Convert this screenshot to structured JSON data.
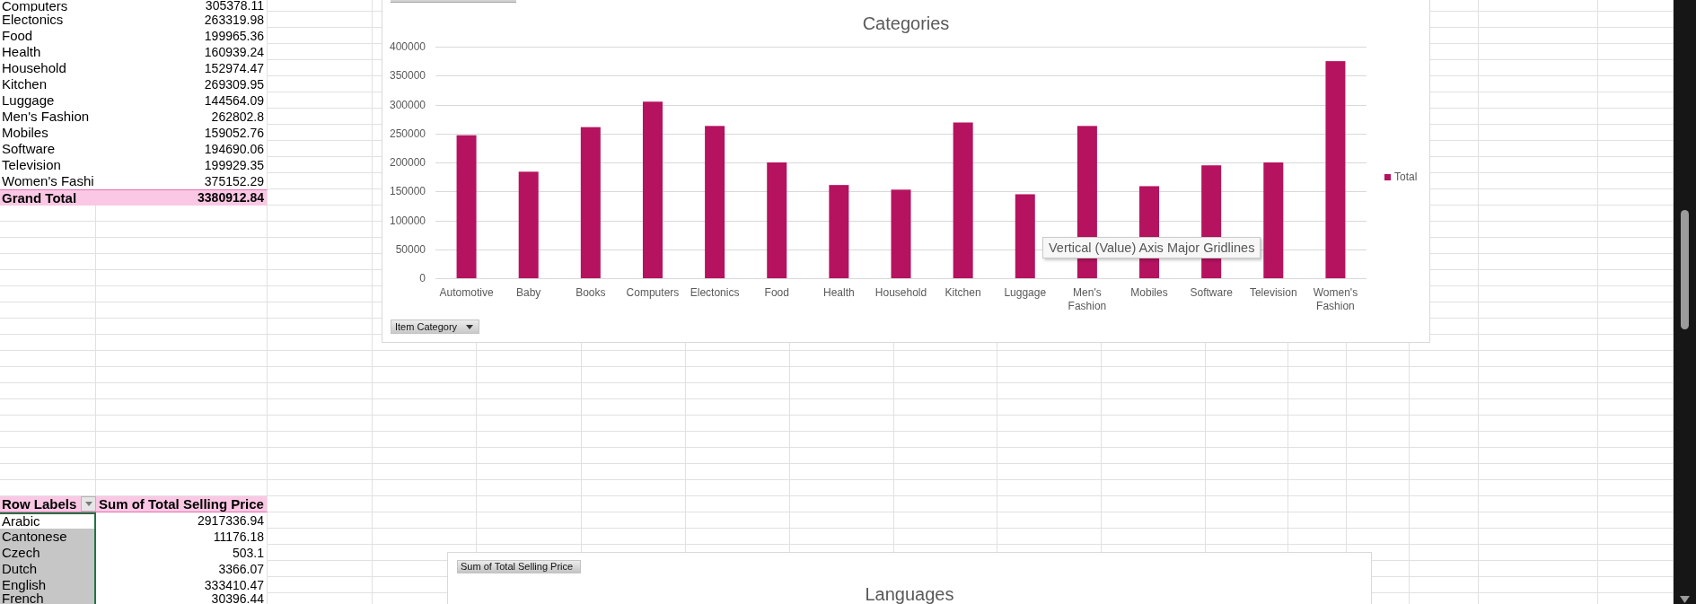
{
  "pivot_categories": {
    "rows": [
      {
        "label": "Computers",
        "value": "305378.11"
      },
      {
        "label": "Electonics",
        "value": "263319.98"
      },
      {
        "label": "Food",
        "value": "199965.36"
      },
      {
        "label": "Health",
        "value": "160939.24"
      },
      {
        "label": "Household",
        "value": "152974.47"
      },
      {
        "label": "Kitchen",
        "value": "269309.95"
      },
      {
        "label": "Luggage",
        "value": "144564.09"
      },
      {
        "label": "Men's Fashion",
        "value": "262802.8"
      },
      {
        "label": "Mobiles",
        "value": "159052.76"
      },
      {
        "label": "Software",
        "value": "194690.06"
      },
      {
        "label": "Television",
        "value": "199929.35"
      },
      {
        "label": "Women's Fashi",
        "value": "375152.29"
      }
    ],
    "grand_total": {
      "label": "Grand Total",
      "value": "3380912.84"
    }
  },
  "chart_categories": {
    "chart_data": {
      "type": "bar",
      "title": "Categories",
      "categories": [
        "Automotive",
        "Baby",
        "Books",
        "Computers",
        "Electonics",
        "Food",
        "Health",
        "Household",
        "Kitchen",
        "Luggage",
        "Men's Fashion",
        "Mobiles",
        "Software",
        "Television",
        "Women's Fashion"
      ],
      "series": [
        {
          "name": "Total",
          "color": "#b5125f",
          "values": [
            247000,
            184000,
            261000,
            305000,
            263000,
            200000,
            161000,
            153000,
            269000,
            145000,
            263000,
            159000,
            195000,
            200000,
            375000
          ]
        }
      ],
      "ylim": [
        0,
        400000
      ],
      "yticks": [
        0,
        50000,
        100000,
        150000,
        200000,
        250000,
        300000,
        350000,
        400000
      ],
      "grid": true
    },
    "axis_field_button": "Item Category",
    "tooltip": "Vertical (Value) Axis Major Gridlines"
  },
  "pivot_languages": {
    "columns": [
      "Row Labels",
      "Sum of Total Selling Price"
    ],
    "rows": [
      {
        "label": "Arabic",
        "value": "2917336.94",
        "selected": true,
        "active": true
      },
      {
        "label": "Cantonese",
        "value": "11176.18",
        "selected": true,
        "active": false
      },
      {
        "label": "Czech",
        "value": "503.1",
        "selected": true,
        "active": false
      },
      {
        "label": "Dutch",
        "value": "3366.07",
        "selected": true,
        "active": false
      },
      {
        "label": "English",
        "value": "333410.47",
        "selected": true,
        "active": false
      },
      {
        "label": "French",
        "value": "30396.44",
        "selected": true,
        "active": false
      }
    ]
  },
  "chart_languages": {
    "value_field_button": "Sum of Total Selling Price",
    "title": "Languages"
  }
}
